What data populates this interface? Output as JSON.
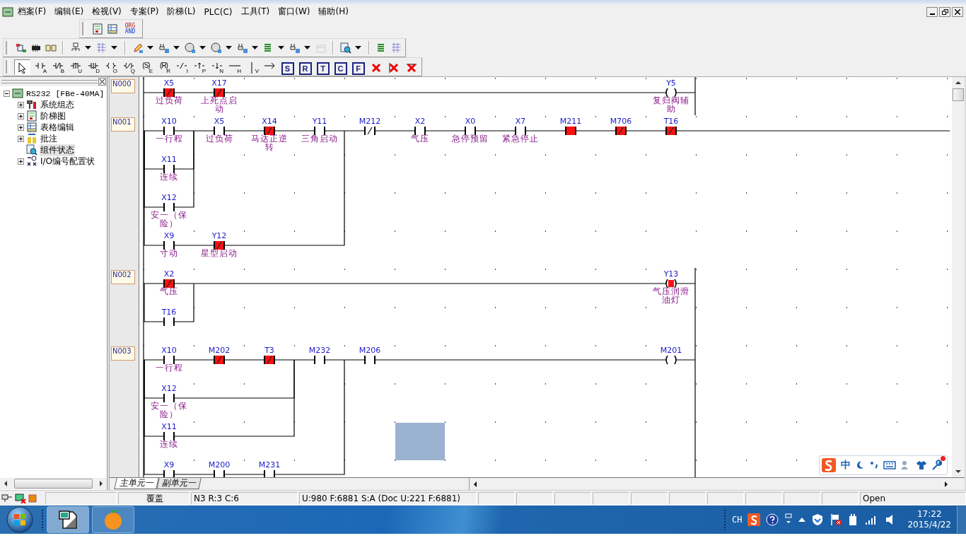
{
  "menu_bar": {
    "items": [
      "档案(F)",
      "编辑(E)",
      "检视(V)",
      "专案(P)",
      "阶梯(L)",
      "PLC(C)",
      "工具(T)",
      "窗口(W)",
      "辅助(H)"
    ]
  },
  "toolbar_view": {
    "org_label": "ORG",
    "and_label": "AND"
  },
  "ladder_toolbar": {
    "tools": [
      {
        "kind": "pointer",
        "selected": true
      },
      {
        "kind": "no",
        "sub": "A",
        "selected": false
      },
      {
        "kind": "nc",
        "sub": "B",
        "selected": false
      },
      {
        "kind": "up",
        "sub": "U",
        "selected": false
      },
      {
        "kind": "down",
        "sub": "D",
        "selected": false
      },
      {
        "kind": "coil",
        "sub": "O",
        "selected": false
      },
      {
        "kind": "ncoil",
        "sub": "Q",
        "selected": false
      },
      {
        "kind": "setcoil",
        "inner": "(S)",
        "sub": "E",
        "selected": false
      },
      {
        "kind": "setcoil",
        "inner": "(R)",
        "sub": "R",
        "selected": false
      },
      {
        "kind": "invert",
        "sub": "I",
        "selected": false
      },
      {
        "kind": "pos",
        "sub": "P",
        "selected": false
      },
      {
        "kind": "neg",
        "sub": "N",
        "selected": false
      },
      {
        "kind": "hline",
        "sub": "H",
        "selected": false
      },
      {
        "kind": "vline",
        "sub": "V",
        "selected": false
      },
      {
        "kind": "arrow",
        "selected": false
      },
      {
        "kind": "letter",
        "letter": "S",
        "selected": false
      },
      {
        "kind": "letter",
        "letter": "R",
        "selected": false
      },
      {
        "kind": "letter",
        "letter": "T",
        "selected": false
      },
      {
        "kind": "letter",
        "letter": "C",
        "selected": false
      },
      {
        "kind": "letter",
        "letter": "F",
        "selected": false
      },
      {
        "kind": "delete",
        "selected": false
      },
      {
        "kind": "delete-vertical",
        "selected": false
      },
      {
        "kind": "delete-horizontal",
        "selected": false
      }
    ]
  },
  "project_tree": {
    "root": {
      "label": "RS232 [FBe-40MA]",
      "expanded": true,
      "children": [
        {
          "label": "系统组态",
          "kind": "folder",
          "expanded": false,
          "selected": false
        },
        {
          "label": "阶梯图",
          "kind": "folder",
          "expanded": false,
          "selected": false
        },
        {
          "label": "表格编辑",
          "kind": "folder",
          "expanded": false,
          "selected": false
        },
        {
          "label": "批注",
          "kind": "folder",
          "expanded": false,
          "selected": false
        },
        {
          "label": "组件状态",
          "kind": "leaf",
          "selected": true
        },
        {
          "label": "I/O编号配置状",
          "kind": "folder",
          "expanded": false,
          "selected": false
        }
      ]
    }
  },
  "ladder": {
    "rungs": [
      {
        "label": "N000",
        "circuit": [
          {
            "kind": "nc-contact",
            "on": true,
            "address": "X5",
            "comment": "过负荷"
          },
          {
            "kind": "nc-contact",
            "on": true,
            "address": "X17",
            "comment": "上死点启动"
          }
        ],
        "coil": {
          "on": false,
          "address": "Y5",
          "comment": "复归阀辅助"
        }
      },
      {
        "label": "N001",
        "circuit": [
          {
            "kind": "parallel",
            "branches": [
              [
                {
                  "kind": "parallel",
                  "branches": [
                    [
                      {
                        "kind": "no-contact",
                        "on": false,
                        "address": "X10",
                        "comment": "一行程"
                      }
                    ],
                    [
                      {
                        "kind": "no-contact",
                        "on": false,
                        "address": "X11",
                        "comment": "连续"
                      }
                    ],
                    [
                      {
                        "kind": "no-contact",
                        "on": false,
                        "address": "X12",
                        "comment": "安一（保险）"
                      }
                    ]
                  ]
                },
                {
                  "kind": "no-contact",
                  "on": false,
                  "address": "X5",
                  "comment": "过负荷"
                },
                {
                  "kind": "nc-contact",
                  "on": true,
                  "address": "X14",
                  "comment": "马达正逆转"
                },
                {
                  "kind": "no-contact",
                  "on": false,
                  "address": "Y11",
                  "comment": "三角启动"
                }
              ],
              [
                {
                  "kind": "no-contact",
                  "on": false,
                  "address": "X9",
                  "comment": "寸动"
                },
                {
                  "kind": "nc-contact",
                  "on": true,
                  "address": "Y12",
                  "comment": "星型启动"
                }
              ]
            ]
          },
          {
            "kind": "nc-contact",
            "on": false,
            "address": "M212"
          },
          {
            "kind": "no-contact",
            "on": false,
            "address": "X2",
            "comment": "气压"
          },
          {
            "kind": "no-contact",
            "on": false,
            "address": "X0",
            "comment": "急停预留"
          },
          {
            "kind": "no-contact",
            "on": false,
            "address": "X7",
            "comment": "紧急停止"
          },
          {
            "kind": "no-contact",
            "on": true,
            "address": "M211"
          },
          {
            "kind": "nc-contact",
            "on": true,
            "address": "M706"
          },
          {
            "kind": "nc-contact",
            "on": true,
            "address": "T16"
          }
        ]
      },
      {
        "label": "N002",
        "circuit": [
          {
            "kind": "parallel",
            "branches": [
              [
                {
                  "kind": "nc-contact",
                  "on": true,
                  "address": "X2",
                  "comment": "气压"
                }
              ],
              [
                {
                  "kind": "no-contact",
                  "on": false,
                  "address": "T16"
                }
              ]
            ]
          }
        ],
        "coil": {
          "on": true,
          "address": "Y13",
          "comment": "气压润滑油灯"
        }
      },
      {
        "label": "N003",
        "circuit": [
          {
            "kind": "parallel",
            "branches": [
              [
                {
                  "kind": "parallel",
                  "branches": [
                    [
                      {
                        "kind": "no-contact",
                        "on": false,
                        "address": "X10",
                        "comment": "一行程"
                      },
                      {
                        "kind": "nc-contact",
                        "on": true,
                        "address": "M202"
                      },
                      {
                        "kind": "nc-contact",
                        "on": true,
                        "address": "T3"
                      }
                    ],
                    [
                      {
                        "kind": "no-contact",
                        "on": false,
                        "address": "X12",
                        "comment": "安一（保险）"
                      }
                    ],
                    [
                      {
                        "kind": "no-contact",
                        "on": false,
                        "address": "X11",
                        "comment": "连续"
                      }
                    ]
                  ]
                },
                {
                  "kind": "no-contact",
                  "on": false,
                  "address": "M232"
                }
              ],
              [
                {
                  "kind": "no-contact",
                  "on": false,
                  "address": "X9"
                },
                {
                  "kind": "no-contact",
                  "on": false,
                  "address": "M200"
                },
                {
                  "kind": "no-contact",
                  "on": false,
                  "address": "M231"
                }
              ]
            ]
          },
          {
            "kind": "no-contact",
            "on": false,
            "address": "M206"
          }
        ],
        "coil": {
          "on": false,
          "address": "M201"
        }
      }
    ]
  },
  "sheet_tabs": [
    {
      "label": "主单元一",
      "selected": true
    },
    {
      "label": "副单元一",
      "selected": false
    }
  ],
  "ime_bar": {
    "mode": "中"
  },
  "status_bar": {
    "mode": "覆盖",
    "position": "N3 R:3 C:6",
    "memory": "U:980 F:6881 S:A (Doc U:221 F:6881)",
    "state": "Open"
  },
  "taskbar": {
    "language": "CH",
    "time": "17:22",
    "date": "2015/4/22"
  }
}
